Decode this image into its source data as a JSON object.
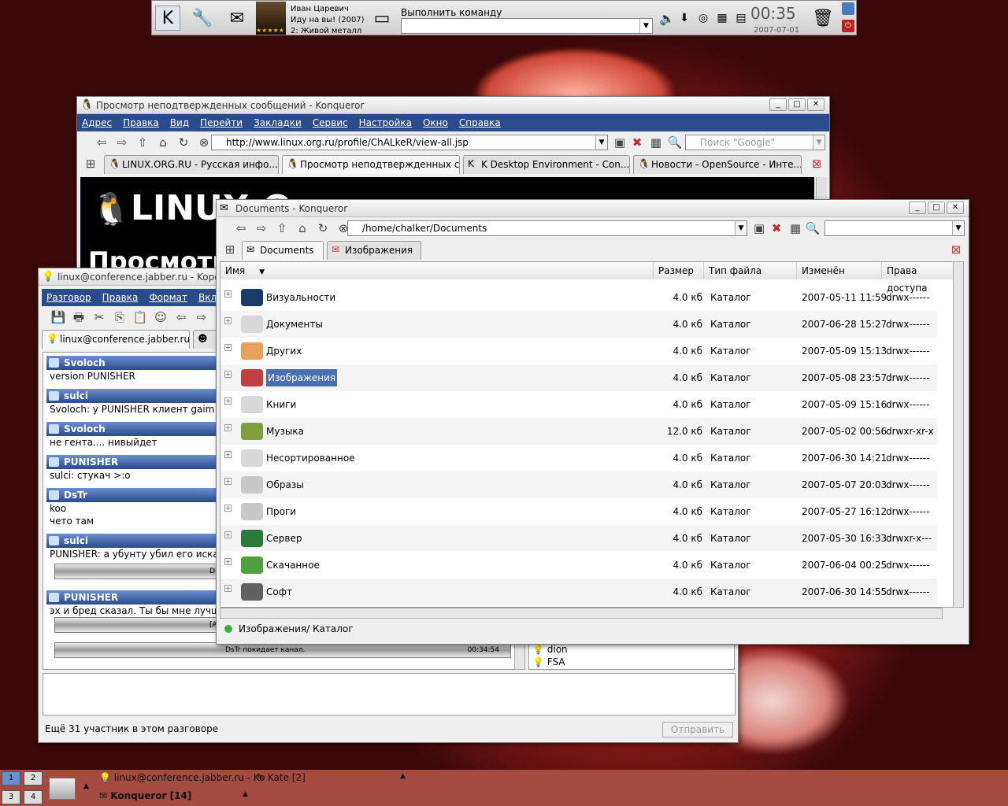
{
  "panel": {
    "media_artist": "Иван Царевич",
    "media_title": "Иду на вы! (2007)",
    "media_rating": "★★★★★",
    "media_track": "2: Живой металл",
    "run_label": "Выполнить команду",
    "clock": "00:35",
    "date": "2007-07-01"
  },
  "konq_back": {
    "title": "Просмотр неподтвержденных сообщений - Konqueror",
    "menu": [
      "Адрес",
      "Правка",
      "Вид",
      "Перейти",
      "Закладки",
      "Сервис",
      "Настройка",
      "Окно",
      "Справка"
    ],
    "url": "http://www.linux.org.ru/profile/ChALkeR/view-all.jsp",
    "search_placeholder": "Поиск \"Google\"",
    "tabs": [
      "LINUX.ORG.RU - Русская инфо...",
      "Просмотр неподтвержденных с...",
      "K Desktop Environment - Con...",
      "Новости - OpenSource - Инте..."
    ],
    "page_logo": "LINUX.O",
    "page_heading": "Просмотр"
  },
  "kopete": {
    "title": "linux@conference.jabber.ru - Kopete",
    "menu": [
      "Разговор",
      "Правка",
      "Формат",
      "Вкл"
    ],
    "tab": "linux@conference.jabber.ru",
    "messages": [
      {
        "nick": "Svoloch",
        "lines": [
          "version PUNISHER"
        ]
      },
      {
        "nick": "sulci",
        "lines": [
          "Svoloch: у PUNISHER клиент gaim 2.0"
        ]
      },
      {
        "nick": "Svoloch",
        "lines": [
          "не гента.... нивыйдет"
        ]
      },
      {
        "nick": "PUNISHER",
        "lines": [
          "sulci: стукач >:o"
        ]
      },
      {
        "nick": "DsTr",
        "lines": [
          "koo",
          "чето там"
        ]
      },
      {
        "nick": "sulci",
        "lines": [
          "PUNISHER: а убунту убил его искать..."
        ]
      },
      {
        "nick": "PUNISHER",
        "lines": [
          "эх и бред сказал.  Ты бы мне лучше п"
        ]
      }
    ],
    "sep1": "D",
    "sep2": "[A",
    "leave_text": "DsTr покидает канал.",
    "leave_time": "00:34:54",
    "users": [
      "dion",
      "FSA"
    ],
    "status": "Ещё 31 участник в этом разговоре",
    "send_label": "Отправить"
  },
  "konq_front": {
    "title": "Documents - Konqueror",
    "url": "/home/chalker/Documents",
    "tabs": [
      "Documents",
      "Изображения"
    ],
    "columns": [
      "Имя",
      "Размер",
      "Тип файла",
      "Изменён",
      "Права доступа"
    ],
    "rows": [
      {
        "name": "Визуальности",
        "size": "4.0 кб",
        "type": "Каталог",
        "modified": "2007-05-11 11:59",
        "perm": "drwx------",
        "color": "#1a3a6a"
      },
      {
        "name": "Документы",
        "size": "4.0 кб",
        "type": "Каталог",
        "modified": "2007-06-28 15:27",
        "perm": "drwx------",
        "color": "#d8d8d8"
      },
      {
        "name": "Других",
        "size": "4.0 кб",
        "type": "Каталог",
        "modified": "2007-05-09 15:13",
        "perm": "drwx------",
        "color": "#e8a060"
      },
      {
        "name": "Изображения",
        "size": "4.0 кб",
        "type": "Каталог",
        "modified": "2007-05-08 23:57",
        "perm": "drwx------",
        "color": "#c04040",
        "selected": true
      },
      {
        "name": "Книги",
        "size": "4.0 кб",
        "type": "Каталог",
        "modified": "2007-05-09 15:16",
        "perm": "drwx------",
        "color": "#d8d8d8"
      },
      {
        "name": "Музыка",
        "size": "12.0 кб",
        "type": "Каталог",
        "modified": "2007-05-02 00:56",
        "perm": "drwxr-xr-x",
        "color": "#80a040"
      },
      {
        "name": "Несортированное",
        "size": "4.0 кб",
        "type": "Каталог",
        "modified": "2007-06-30 14:21",
        "perm": "drwx------",
        "color": "#d8d8d8"
      },
      {
        "name": "Образы",
        "size": "4.0 кб",
        "type": "Каталог",
        "modified": "2007-05-07 20:03",
        "perm": "drwx------",
        "color": "#c8c8c8"
      },
      {
        "name": "Проги",
        "size": "4.0 кб",
        "type": "Каталог",
        "modified": "2007-05-27 16:12",
        "perm": "drwx------",
        "color": "#c8c8c8"
      },
      {
        "name": "Сервер",
        "size": "4.0 кб",
        "type": "Каталог",
        "modified": "2007-05-30 16:33",
        "perm": "drwxr-x---",
        "color": "#2a7a3a"
      },
      {
        "name": "Скачанное",
        "size": "4.0 кб",
        "type": "Каталог",
        "modified": "2007-06-04 00:25",
        "perm": "drwx------",
        "color": "#50a040"
      },
      {
        "name": "Софт",
        "size": "4.0 кб",
        "type": "Каталог",
        "modified": "2007-06-30 14:55",
        "perm": "drwx------",
        "color": "#606060"
      }
    ],
    "status": "Изображения/  Каталог"
  },
  "taskbar": {
    "desktops": [
      "1",
      "2",
      "3",
      "4"
    ],
    "task1": "linux@conference.jabber.ru - Ko",
    "task2": "Kate [2]",
    "task3": "Konqueror [14]"
  }
}
